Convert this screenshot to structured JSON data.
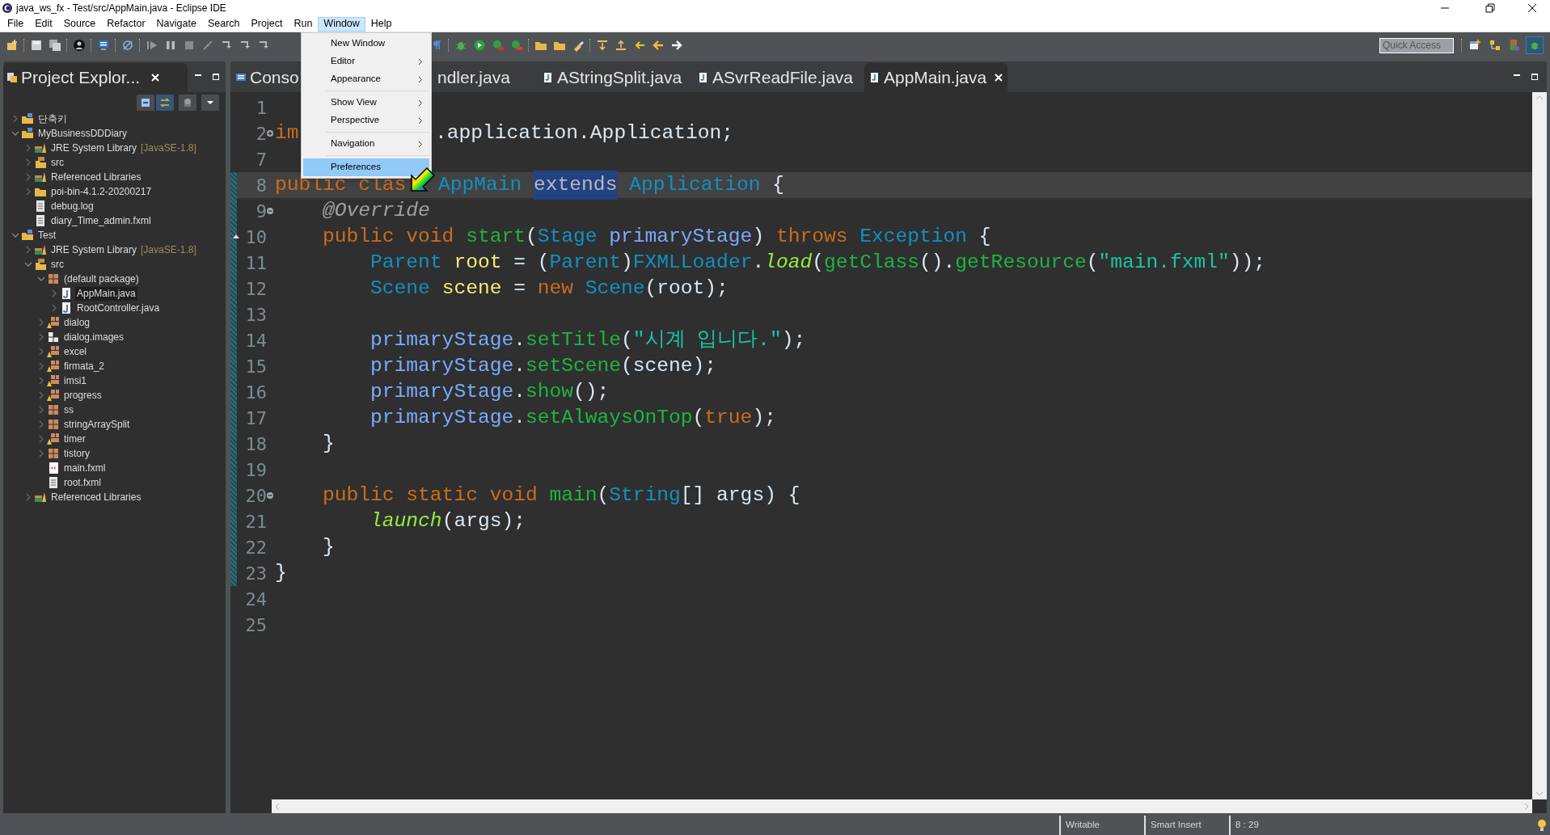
{
  "window": {
    "title": "java_ws_fx - Test/src/AppMain.java - Eclipse IDE"
  },
  "menu_bar": [
    {
      "label": "File",
      "selected": false
    },
    {
      "label": "Edit",
      "selected": false
    },
    {
      "label": "Source",
      "selected": false
    },
    {
      "label": "Refactor",
      "selected": false
    },
    {
      "label": "Navigate",
      "selected": false
    },
    {
      "label": "Search",
      "selected": false
    },
    {
      "label": "Project",
      "selected": false
    },
    {
      "label": "Run",
      "selected": false
    },
    {
      "label": "Window",
      "selected": true
    },
    {
      "label": "Help",
      "selected": false
    }
  ],
  "window_menu": [
    {
      "kind": "item",
      "label": "New Window",
      "submenu": false,
      "selected": false
    },
    {
      "kind": "item",
      "label": "Editor",
      "submenu": true,
      "selected": false
    },
    {
      "kind": "item",
      "label": "Appearance",
      "submenu": true,
      "selected": false
    },
    {
      "kind": "separator"
    },
    {
      "kind": "item",
      "label": "Show View",
      "submenu": true,
      "selected": false
    },
    {
      "kind": "item",
      "label": "Perspective",
      "submenu": true,
      "selected": false
    },
    {
      "kind": "separator"
    },
    {
      "kind": "item",
      "label": "Navigation",
      "submenu": true,
      "selected": false
    },
    {
      "kind": "separator"
    },
    {
      "kind": "item",
      "label": "Preferences",
      "submenu": false,
      "selected": true
    }
  ],
  "toolbar": {
    "quick_access": {
      "placeholder": "Quick Access"
    }
  },
  "project_explorer": {
    "title": "Project Explor...",
    "tree": [
      {
        "kind": "project",
        "label": "단축키",
        "expanded": false,
        "selected": false
      },
      {
        "kind": "project",
        "label": "MyBusinessDDDiary",
        "expanded": true,
        "selected": false,
        "children": [
          {
            "kind": "library",
            "label": "JRE System Library",
            "decoration": "[JavaSE-1.8]",
            "expanded": false,
            "selected": false
          },
          {
            "kind": "source-folder",
            "label": "src",
            "expanded": false,
            "selected": false
          },
          {
            "kind": "library",
            "label": "Referenced Libraries",
            "expanded": false,
            "selected": false
          },
          {
            "kind": "folder",
            "label": "poi-bin-4.1.2-20200217",
            "expanded": false,
            "selected": false
          },
          {
            "kind": "file",
            "label": "debug.log",
            "selected": false
          },
          {
            "kind": "file",
            "label": "diary_Time_admin.fxml",
            "selected": false
          }
        ]
      },
      {
        "kind": "project",
        "label": "Test",
        "expanded": true,
        "selected": false,
        "children": [
          {
            "kind": "library",
            "label": "JRE System Library",
            "decoration": "[JavaSE-1.8]",
            "expanded": false,
            "selected": false
          },
          {
            "kind": "source-folder",
            "label": "src",
            "expanded": true,
            "selected": false,
            "children": [
              {
                "kind": "package",
                "label": "(default package)",
                "expanded": true,
                "selected": false,
                "children": [
                  {
                    "kind": "java-file",
                    "label": "AppMain.java",
                    "expanded": false,
                    "selected": true
                  },
                  {
                    "kind": "java-file",
                    "label": "RootController.java",
                    "expanded": false,
                    "selected": false
                  }
                ]
              },
              {
                "kind": "package-warning",
                "label": "dialog",
                "expanded": false,
                "selected": false
              },
              {
                "kind": "package-empty",
                "label": "dialog.images",
                "expanded": false,
                "selected": false
              },
              {
                "kind": "package-warning",
                "label": "excel",
                "expanded": false,
                "selected": false
              },
              {
                "kind": "package-warning",
                "label": "firmata_2",
                "expanded": false,
                "selected": false
              },
              {
                "kind": "package-warning",
                "label": "imsi1",
                "expanded": false,
                "selected": false
              },
              {
                "kind": "package-warning",
                "label": "progress",
                "expanded": false,
                "selected": false
              },
              {
                "kind": "package",
                "label": "ss",
                "expanded": false,
                "selected": false
              },
              {
                "kind": "package",
                "label": "stringArraySplit",
                "expanded": false,
                "selected": false
              },
              {
                "kind": "package-warning",
                "label": "timer",
                "expanded": false,
                "selected": false
              },
              {
                "kind": "package",
                "label": "tistory",
                "expanded": false,
                "selected": false
              },
              {
                "kind": "fxml-file",
                "label": "main.fxml",
                "selected": false
              },
              {
                "kind": "file",
                "label": "root.fxml",
                "selected": false
              }
            ]
          },
          {
            "kind": "library",
            "label": "Referenced Libraries",
            "expanded": false,
            "selected": false
          }
        ]
      }
    ]
  },
  "editor": {
    "tabs": [
      {
        "kind": "console",
        "label": "Conso",
        "selected": false
      },
      {
        "kind": "java",
        "label": "ndler.java",
        "selected": false
      },
      {
        "kind": "java",
        "label": "AStringSplit.java",
        "selected": false
      },
      {
        "kind": "java",
        "label": "ASvrReadFile.java",
        "selected": false
      },
      {
        "kind": "java",
        "label": "AppMain.java",
        "selected": true
      }
    ],
    "lines": [
      {
        "number": "1",
        "current": false
      },
      {
        "number": "2",
        "current": false,
        "kind": "fold-expand",
        "tokens": [
          {
            "kind": "kw",
            "text": "im"
          },
          {
            "kind": "plain",
            "text": ".application.Application;",
            "covered_before": true
          }
        ]
      },
      {
        "number": "7",
        "current": false
      },
      {
        "number": "8",
        "current": true,
        "tokens": [
          {
            "kind": "kw",
            "text": "public clas"
          },
          {
            "kind": "type",
            "text": "AppMain ",
            "covered_before": true
          },
          {
            "kind": "selected-keyword",
            "text": "extends"
          },
          {
            "kind": "type",
            "text": " Application"
          },
          {
            "kind": "plain",
            "text": " {"
          }
        ]
      },
      {
        "number": "9",
        "current": false,
        "kind": "fold-collapse",
        "tokens": [
          {
            "kind": "annotation",
            "text": "    @Override"
          }
        ]
      },
      {
        "number": "10",
        "current": false,
        "kind": "override",
        "tokens": [
          {
            "kind": "kw",
            "text": "    public void "
          },
          {
            "kind": "method",
            "text": "start"
          },
          {
            "kind": "plain",
            "text": "("
          },
          {
            "kind": "type",
            "text": "Stage "
          },
          {
            "kind": "param",
            "text": "primaryStage"
          },
          {
            "kind": "plain",
            "text": ") "
          },
          {
            "kind": "kw",
            "text": "throws "
          },
          {
            "kind": "type",
            "text": "Exception"
          },
          {
            "kind": "plain",
            "text": " {"
          }
        ]
      },
      {
        "number": "11",
        "current": false,
        "tokens": [
          {
            "kind": "type",
            "text": "        Parent "
          },
          {
            "kind": "local",
            "text": "root"
          },
          {
            "kind": "plain",
            "text": " = ("
          },
          {
            "kind": "type",
            "text": "Parent"
          },
          {
            "kind": "plain",
            "text": ")"
          },
          {
            "kind": "type",
            "text": "FXMLLoader"
          },
          {
            "kind": "plain",
            "text": "."
          },
          {
            "kind": "static",
            "text": "load"
          },
          {
            "kind": "plain",
            "text": "("
          },
          {
            "kind": "method",
            "text": "getClass"
          },
          {
            "kind": "plain",
            "text": "()."
          },
          {
            "kind": "method",
            "text": "getResource"
          },
          {
            "kind": "plain",
            "text": "("
          },
          {
            "kind": "string",
            "text": "\"main.fxml\""
          },
          {
            "kind": "plain",
            "text": "));"
          }
        ]
      },
      {
        "number": "12",
        "current": false,
        "tokens": [
          {
            "kind": "type",
            "text": "        Scene "
          },
          {
            "kind": "local",
            "text": "scene"
          },
          {
            "kind": "plain",
            "text": " = "
          },
          {
            "kind": "kw",
            "text": "new "
          },
          {
            "kind": "type",
            "text": "Scene"
          },
          {
            "kind": "plain",
            "text": "(root);"
          }
        ]
      },
      {
        "number": "13",
        "current": false
      },
      {
        "number": "14",
        "current": false,
        "tokens": [
          {
            "kind": "param",
            "text": "        primaryStage"
          },
          {
            "kind": "plain",
            "text": "."
          },
          {
            "kind": "method",
            "text": "setTitle"
          },
          {
            "kind": "plain",
            "text": "("
          },
          {
            "kind": "string",
            "text": "\"시계 입니다.\""
          },
          {
            "kind": "plain",
            "text": ");"
          }
        ]
      },
      {
        "number": "15",
        "current": false,
        "tokens": [
          {
            "kind": "param",
            "text": "        primaryStage"
          },
          {
            "kind": "plain",
            "text": "."
          },
          {
            "kind": "method",
            "text": "setScene"
          },
          {
            "kind": "plain",
            "text": "(scene);"
          }
        ]
      },
      {
        "number": "16",
        "current": false,
        "tokens": [
          {
            "kind": "param",
            "text": "        primaryStage"
          },
          {
            "kind": "plain",
            "text": "."
          },
          {
            "kind": "method",
            "text": "show"
          },
          {
            "kind": "plain",
            "text": "();"
          }
        ]
      },
      {
        "number": "17",
        "current": false,
        "tokens": [
          {
            "kind": "param",
            "text": "        primaryStage"
          },
          {
            "kind": "plain",
            "text": "."
          },
          {
            "kind": "method",
            "text": "setAlwaysOnTop"
          },
          {
            "kind": "plain",
            "text": "("
          },
          {
            "kind": "kw",
            "text": "true"
          },
          {
            "kind": "plain",
            "text": ");"
          }
        ]
      },
      {
        "number": "18",
        "current": false,
        "tokens": [
          {
            "kind": "plain",
            "text": "    }"
          }
        ]
      },
      {
        "number": "19",
        "current": false
      },
      {
        "number": "20",
        "current": false,
        "kind": "fold-collapse",
        "tokens": [
          {
            "kind": "kw",
            "text": "    public static void "
          },
          {
            "kind": "method",
            "text": "main"
          },
          {
            "kind": "plain",
            "text": "("
          },
          {
            "kind": "type",
            "text": "String"
          },
          {
            "kind": "plain",
            "text": "[] args) {"
          }
        ]
      },
      {
        "number": "21",
        "current": false,
        "tokens": [
          {
            "kind": "static",
            "text": "        launch"
          },
          {
            "kind": "plain",
            "text": "(args);"
          }
        ]
      },
      {
        "number": "22",
        "current": false,
        "tokens": [
          {
            "kind": "plain",
            "text": "    }"
          }
        ]
      },
      {
        "number": "23",
        "current": false,
        "tokens": [
          {
            "kind": "plain",
            "text": "}"
          }
        ]
      },
      {
        "number": "24",
        "current": false
      },
      {
        "number": "25",
        "current": false
      }
    ]
  },
  "status_bar": [
    "Writable",
    "Smart Insert",
    "8 : 29"
  ]
}
